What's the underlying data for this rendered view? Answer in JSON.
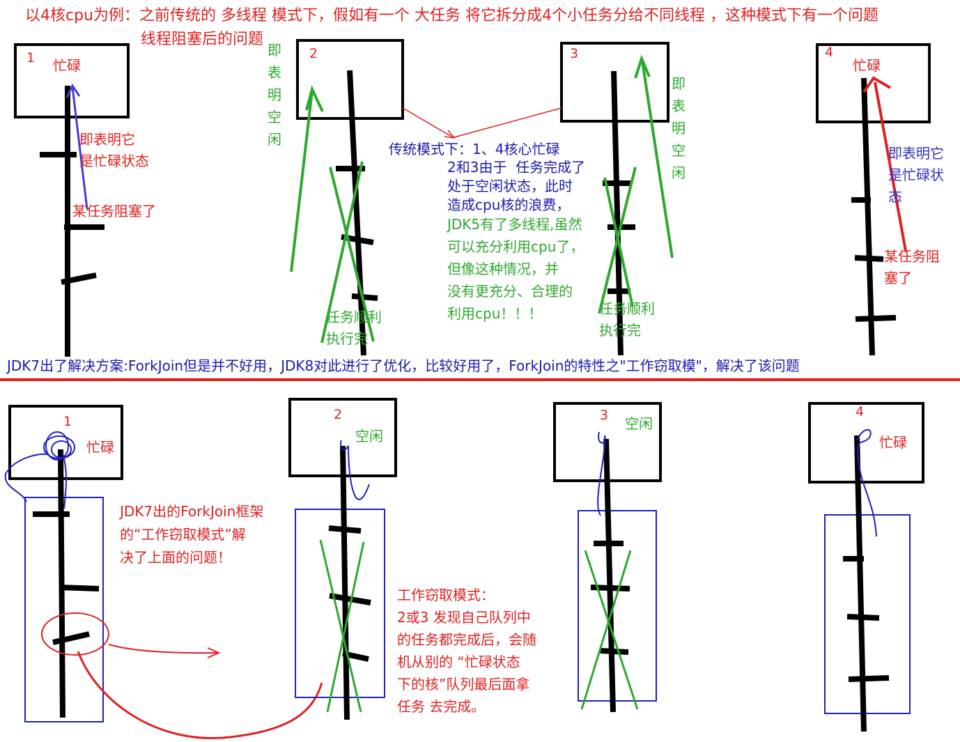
{
  "header": {
    "line1": "以4核cpu为例：之前传统的 多线程 模式下，假如有一个 大任务 将它拆分成4个小任务分给不同线程 ，这种模式下有一个问题",
    "line2": "线程阻塞后的问题"
  },
  "top": {
    "cores": [
      {
        "number": "1",
        "status": "忙碌",
        "busy_note": "即表明它\n是忙碌状态",
        "blocked_note": "某任务阻塞了"
      },
      {
        "number": "2",
        "idle_note": "即表明空闲",
        "done_note": "任务顺利\n执行完"
      },
      {
        "number": "3",
        "idle_note": "即表明空闲",
        "done_note": "任务顺利\n执行完"
      },
      {
        "number": "4",
        "status": "忙碌",
        "busy_note": "即表明它\n是忙碌状\n态",
        "blocked_note": "某任务阻\n塞了"
      }
    ],
    "center": {
      "title": "传统模式下：1、4核心忙碌",
      "body": "2和3由于  任务完成了\n处于空闲状态，此时\n造成cpu核的浪费，",
      "jdk5_note": "JDK5有了多线程,虽然\n可以充分利用cpu了，\n但像这种情况，并\n没有更充分、合理的\n利用cpu！！！"
    }
  },
  "divider_caption": "JDK7出了解决方案:ForkJoin但是并不好用，JDK8对此进行了优化，比较好用了，ForkJoin的特性之\"工作窃取模\"，解决了该问题",
  "bottom": {
    "cores": [
      {
        "number": "1",
        "status": "忙碌"
      },
      {
        "number": "2",
        "status": "空闲"
      },
      {
        "number": "3",
        "status": "空闲"
      },
      {
        "number": "4",
        "status": "忙碌"
      }
    ],
    "forkjoin_note": "JDK7出的ForkJoin框架\n的“工作窃取模式”解\n决了上面的问题！",
    "work_stealing_note": "工作窃取模式：\n2或3 发现自己队列中\n的任务都完成后，会随\n机从别的 “忙碌状态\n下的核”队列最后面拿\n任务 去完成。"
  },
  "colors": {
    "red": "#e02020",
    "green": "#2ea82e",
    "blue": "#1a1ab0",
    "black": "#000000"
  }
}
